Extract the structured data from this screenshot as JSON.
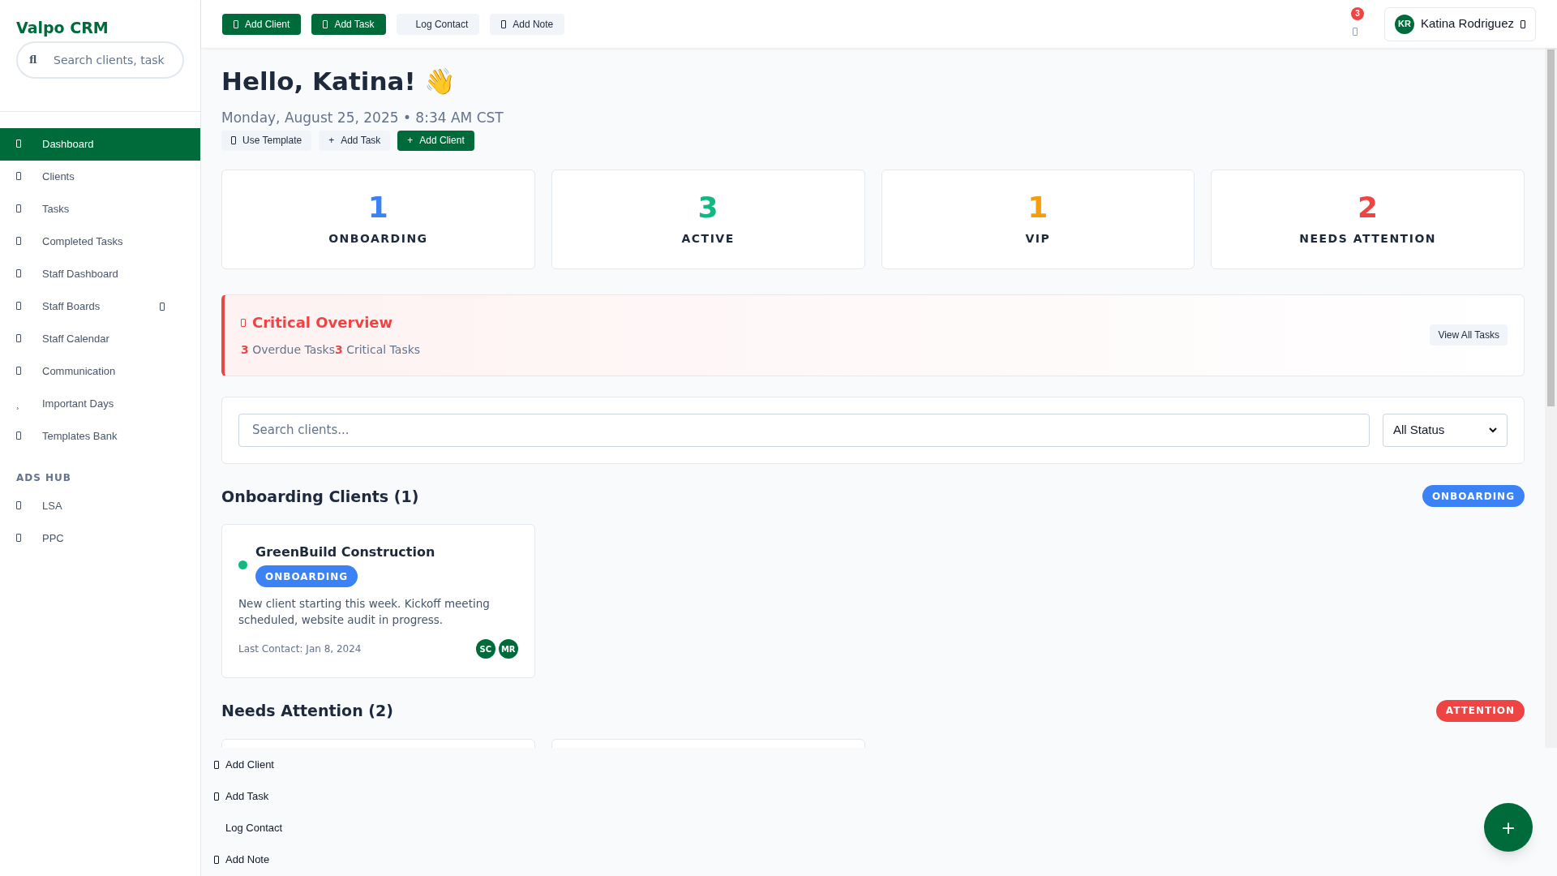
{
  "sidebar": {
    "brand": "Valpo CRM",
    "search": {
      "glyph": "fl",
      "placeholder": "Search clients, task"
    },
    "items": [
      {
        "label": "Dashboard",
        "selected": true
      },
      {
        "label": "Clients",
        "selected": false
      },
      {
        "label": "Tasks",
        "selected": false
      },
      {
        "label": "Completed Tasks",
        "selected": false
      },
      {
        "label": "Staff Dashboard",
        "selected": false
      },
      {
        "label": "Staff Boards",
        "selected": false,
        "expandable": true
      },
      {
        "label": "Staff Calendar",
        "selected": false
      },
      {
        "label": "Communication",
        "selected": false
      },
      {
        "label": "Important Days",
        "selected": false,
        "glyph": "¸"
      },
      {
        "label": "Templates Bank",
        "selected": false
      }
    ],
    "section": "ADS HUB",
    "section_items": [
      {
        "label": "LSA",
        "selected": false
      },
      {
        "label": "PPC",
        "selected": false
      }
    ]
  },
  "topbar": {
    "buttons": [
      {
        "label": "Add Client",
        "kind": "primary",
        "icon": true
      },
      {
        "label": "Add Task",
        "kind": "primary",
        "icon": true
      },
      {
        "label": "Log Contact",
        "kind": "secondary",
        "icon": false
      },
      {
        "label": "Add Note",
        "kind": "secondary",
        "icon": true
      }
    ],
    "notifications": "3",
    "user": {
      "initials": "KR",
      "name": "Katina Rodriguez"
    }
  },
  "greeting": {
    "title": "Hello, Katina! 👋",
    "date": "Monday, August 25, 2025 • 8:34 AM CST",
    "buttons": [
      {
        "label": "Use Template",
        "kind": "secondary"
      },
      {
        "label": "Add Task",
        "kind": "secondary",
        "glyph": "+"
      },
      {
        "label": "Add Client",
        "kind": "primary",
        "glyph": "+"
      }
    ]
  },
  "stats": [
    {
      "value": "1",
      "label": "ONBOARDING",
      "color": "#3b82f6"
    },
    {
      "value": "3",
      "label": "ACTIVE",
      "color": "#10b981"
    },
    {
      "value": "1",
      "label": "VIP",
      "color": "#f59e0b"
    },
    {
      "value": "2",
      "label": "NEEDS ATTENTION",
      "color": "#ef4444"
    }
  ],
  "critical": {
    "title": "Critical Overview",
    "items": [
      "**3** Overdue Tasks",
      "**3** Critical Tasks"
    ],
    "button": "View All Tasks"
  },
  "filter": {
    "placeholder": "Search clients...",
    "status": "All Status"
  },
  "sections": [
    {
      "title": "Onboarding Clients (1)",
      "badge": "ONBOARDING",
      "color": "#3b82f6",
      "clients": [
        {
          "name": "GreenBuild Construction",
          "color": "#10b981",
          "status": {
            "label": "ONBOARDING",
            "color": "#3b82f6"
          },
          "note": "New client starting this week. Kickoff meeting scheduled, website audit in progress.",
          "last_contact": "Last Contact: Jan 8, 2024",
          "staff": [
            "SC",
            "MR"
          ]
        }
      ]
    },
    {
      "title": "Needs Attention (2)",
      "badge": "ATTENTION",
      "color": "#ef4444",
      "clients": [
        {
          "kind": "empty"
        },
        {
          "kind": "empty"
        }
      ]
    }
  ],
  "quick_menu": [
    {
      "label": "Add Client",
      "icon": true
    },
    {
      "label": "Add Task",
      "icon": true
    },
    {
      "label": "Log Contact",
      "icon": false
    },
    {
      "label": "Add Note",
      "icon": true
    }
  ],
  "fab": "+"
}
